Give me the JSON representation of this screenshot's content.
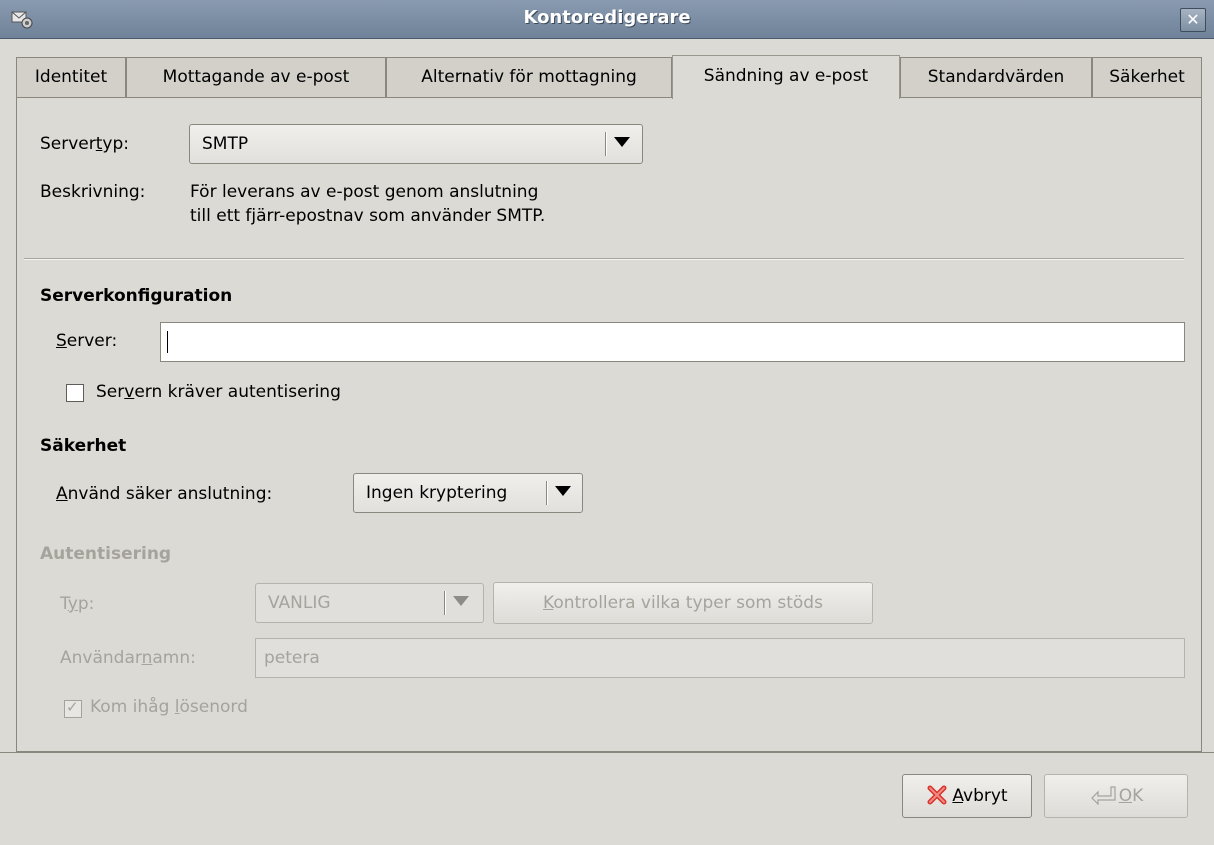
{
  "window": {
    "title": "Kontoredigerare",
    "close_glyph": "✕"
  },
  "tabs": [
    {
      "label": "Identitet",
      "active": false
    },
    {
      "label": "Mottagande av e-post",
      "active": false
    },
    {
      "label": "Alternativ för mottagning",
      "active": false
    },
    {
      "label": "Sändning av e-post",
      "active": true
    },
    {
      "label": "Standardvärden",
      "active": false
    },
    {
      "label": "Säkerhet",
      "active": false
    }
  ],
  "server_type": {
    "label_pre": "Server",
    "label_underline": "t",
    "label_post": "yp:",
    "value": "SMTP",
    "description_label": "Beskrivning:",
    "description_line1": "För leverans av e-post genom anslutning",
    "description_line2": "till ett fjärr-epostnav som använder SMTP."
  },
  "server_config": {
    "title": "Serverkonfiguration",
    "server_label_underline": "S",
    "server_label_post": "erver:",
    "server_value": "",
    "auth_checkbox_pre": "Ser",
    "auth_checkbox_underline": "v",
    "auth_checkbox_post": "ern kräver autentisering",
    "auth_checked": false
  },
  "security": {
    "title": "Säkerhet",
    "secure_label_underline": "A",
    "secure_label_post": "nvänd säker anslutning:",
    "secure_value": "Ingen kryptering"
  },
  "authentication": {
    "title": "Autentisering",
    "type_label_pre": "T",
    "type_label_underline": "y",
    "type_label_post": "p:",
    "type_value": "VANLIG",
    "check_button_underline": "K",
    "check_button_post": "ontrollera vilka typer som stöds",
    "username_label_pre": "Användar",
    "username_label_underline": "n",
    "username_label_post": "amn:",
    "username_value": "petera",
    "remember_pre": "Kom ihåg ",
    "remember_underline": "l",
    "remember_post": "ösenord",
    "remember_checked": true,
    "check_glyph": "✓"
  },
  "buttons": {
    "cancel_underline": "A",
    "cancel_post": "vbryt",
    "ok_underline": "O",
    "ok_post": "K"
  }
}
